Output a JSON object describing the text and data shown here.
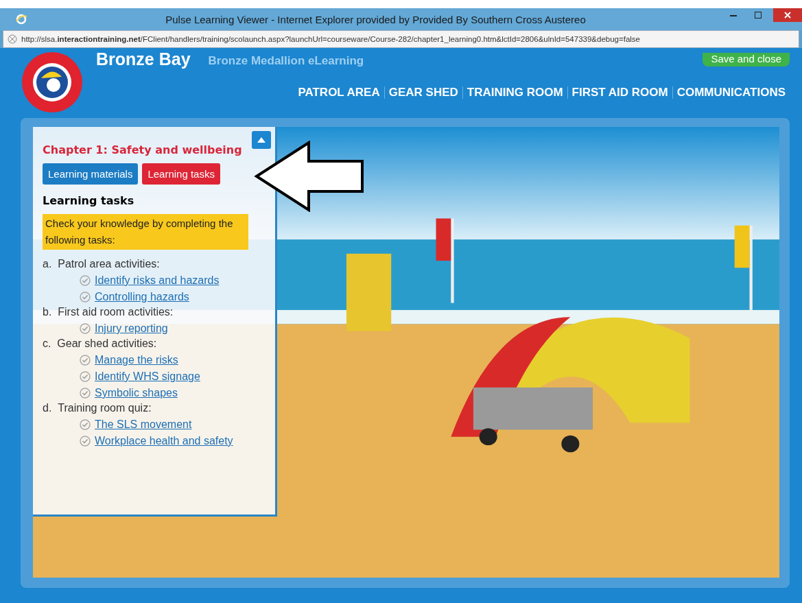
{
  "window": {
    "title": "Pulse Learning Viewer - Internet Explorer provided by Provided By Southern Cross Austereo"
  },
  "address_bar": {
    "url": "http://slsa.**interactiontraining.net**/FClient/handlers/training/scolaunch.aspx?launchUrl=courseware/Course-282/chapter1_learning0.htm&lctId=2806&ulnId=547339&debug=false"
  },
  "header": {
    "title": "Bronze Bay",
    "subtitle": "Bronze Medallion eLearning",
    "save_button": "Save and close",
    "nav": [
      "PATROL AREA",
      "GEAR SHED",
      "TRAINING ROOM",
      "FIRST AID ROOM",
      "COMMUNICATIONS"
    ]
  },
  "panel": {
    "chapter": "Chapter 1: Safety and wellbeing",
    "tabs": [
      {
        "label": "Learning materials",
        "selected": false
      },
      {
        "label": "Learning tasks",
        "selected": true
      }
    ],
    "heading": "Learning tasks",
    "intro": "Check your knowledge by completing the following tasks:",
    "sections": [
      {
        "marker": "a.",
        "title": "Patrol area activities:",
        "tasks": [
          "Identify risks and hazards",
          "Controlling hazards"
        ]
      },
      {
        "marker": "b.",
        "title": "First aid room activities:",
        "tasks": [
          "Injury reporting"
        ]
      },
      {
        "marker": "c.",
        "title": "Gear shed activities:",
        "tasks": [
          "Manage the risks",
          "Identify WHS signage",
          "Symbolic shapes"
        ]
      },
      {
        "marker": "d.",
        "title": "Training room quiz:",
        "tasks": [
          "The SLS movement",
          "Workplace health and safety"
        ]
      }
    ]
  }
}
